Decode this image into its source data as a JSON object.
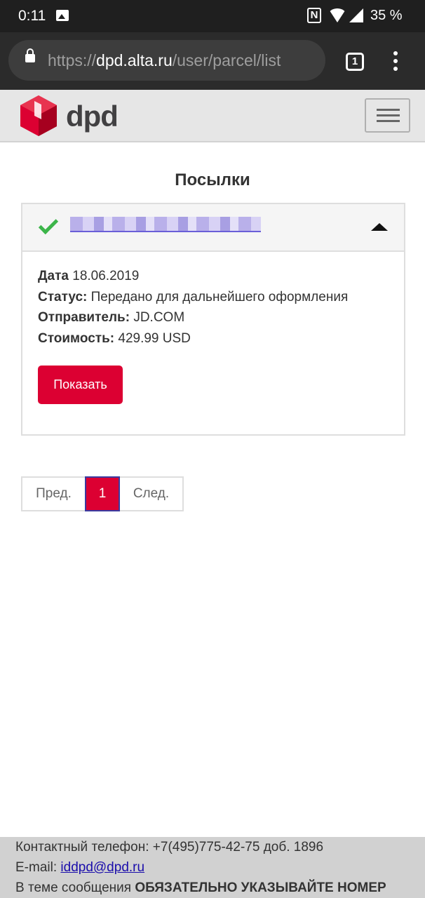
{
  "status_bar": {
    "time": "0:11",
    "battery": "35 %"
  },
  "browser": {
    "url_prefix": "https://",
    "url_host": "dpd.alta.ru",
    "url_path": "/user/parcel/list",
    "tab_count": "1"
  },
  "header": {
    "logo_text": "dpd"
  },
  "page": {
    "title": "Посылки"
  },
  "parcel": {
    "tracking_number": "",
    "date_label": "Дата",
    "date_value": "18.06.2019",
    "status_label": "Статус:",
    "status_value": "Передано для дальнейшего оформления",
    "sender_label": "Отправитель:",
    "sender_value": "JD.COM",
    "cost_label": "Стоимость:",
    "cost_value": "429.99 USD",
    "show_button": "Показать"
  },
  "pagination": {
    "prev": "Пред.",
    "current": "1",
    "next": "След."
  },
  "footer": {
    "phone_line": "Контактный телефон: +7(495)775-42-75 доб. 1896",
    "email_label": "E-mail: ",
    "email": "iddpd@dpd.ru",
    "subject_prefix": "В теме сообщения ",
    "subject_bold": "ОБЯЗАТЕЛЬНО УКАЗЫВАЙТЕ НОМЕР"
  },
  "colors": {
    "brand_red": "#dc0032",
    "check_green": "#3cb54a"
  }
}
